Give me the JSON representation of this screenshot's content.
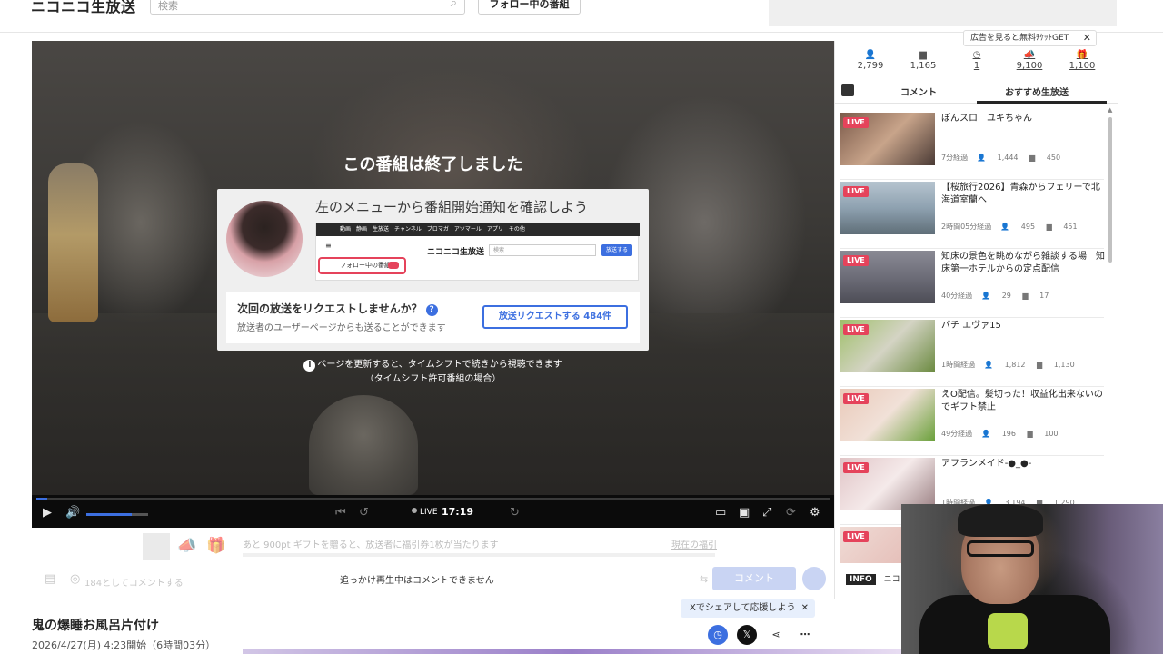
{
  "header": {
    "logo": "ニコニコ生放送",
    "search_placeholder": "検索",
    "follow_button": "フォロー中の番組"
  },
  "player": {
    "ended_title": "この番組は終了しました",
    "card": {
      "title": "左のメニューから番組開始通知を確認しよう",
      "mini_menu_items": "動画　静画　生放送　チャンネル　ブロマガ　アツマール　アプリ　その他",
      "mini_logo": "ニコニコ生放送",
      "mini_search": "検索",
      "mini_button": "放送する",
      "mini_follow": "フォロー中の番組",
      "request_title": "次回の放送をリクエストしませんか？",
      "request_sub": "放送者のユーザーページからも送ることができます",
      "request_button": "放送リクエストする 484件"
    },
    "notice_line1": "ページを更新すると、タイムシフトで続きから視聴できます",
    "notice_line2": "（タイムシフト許可番組の場合）",
    "live_label": "LIVE",
    "time": "17:19"
  },
  "below": {
    "gift_text": "あと 900pt ギフトを贈ると、放送者に福引券1枚が当たります",
    "gift_link": "現在の福引",
    "comment_placeholder": "184としてコメントする",
    "comment_disabled": "追っかけ再生中はコメントできません",
    "comment_button": "コメント"
  },
  "program": {
    "title": "鬼の爆睡お風呂片付け",
    "date": "2026/4/27(月) 4:23開始（6時間03分）",
    "share_pill": "Xでシェアして応援しよう"
  },
  "sidebar": {
    "stats": [
      {
        "icon": "viewer-icon",
        "value": "2,799"
      },
      {
        "icon": "comment-icon",
        "value": "1,165"
      },
      {
        "icon": "timeshift-icon",
        "value": "1"
      },
      {
        "icon": "ad-icon",
        "value": "9,100"
      },
      {
        "icon": "gift-icon",
        "value": "1,100"
      }
    ],
    "ad_tip": "広告を見ると無料ﾁｹｯﾄGET",
    "tabs": [
      "コメント",
      "おすすめ生放送"
    ],
    "recommendations": [
      {
        "live": "LIVE",
        "title": "ぽんスロ　ユキちゃん",
        "elapsed": "7分経過",
        "viewers": "1,444",
        "comments": "450"
      },
      {
        "live": "LIVE",
        "title": "【桜旅行2026】青森からフェリーで北海道室蘭へ",
        "elapsed": "2時間05分経過",
        "viewers": "495",
        "comments": "451"
      },
      {
        "live": "LIVE",
        "title": "知床の景色を眺めながら雑談する場　知床第一ホテルからの定点配信",
        "elapsed": "40分経過",
        "viewers": "29",
        "comments": "17"
      },
      {
        "live": "LIVE",
        "title": "パチ エヴァ15",
        "elapsed": "1時間経過",
        "viewers": "1,812",
        "comments": "1,130"
      },
      {
        "live": "LIVE",
        "title": "えO配信。髪切った！収益化出来ないのでギフト禁止",
        "elapsed": "49分経過",
        "viewers": "196",
        "comments": "100"
      },
      {
        "live": "LIVE",
        "title": "アフランメイド-●_●-",
        "elapsed": "1時間経過",
        "viewers": "3,194",
        "comments": "1,290"
      },
      {
        "live": "LIVE",
        "title": "",
        "elapsed": "",
        "viewers": "",
        "comments": ""
      }
    ],
    "info_tag": "INFO",
    "info_text": "ニコ"
  },
  "colors": {
    "accent": "#3c6fe0",
    "live": "#e5435b"
  }
}
